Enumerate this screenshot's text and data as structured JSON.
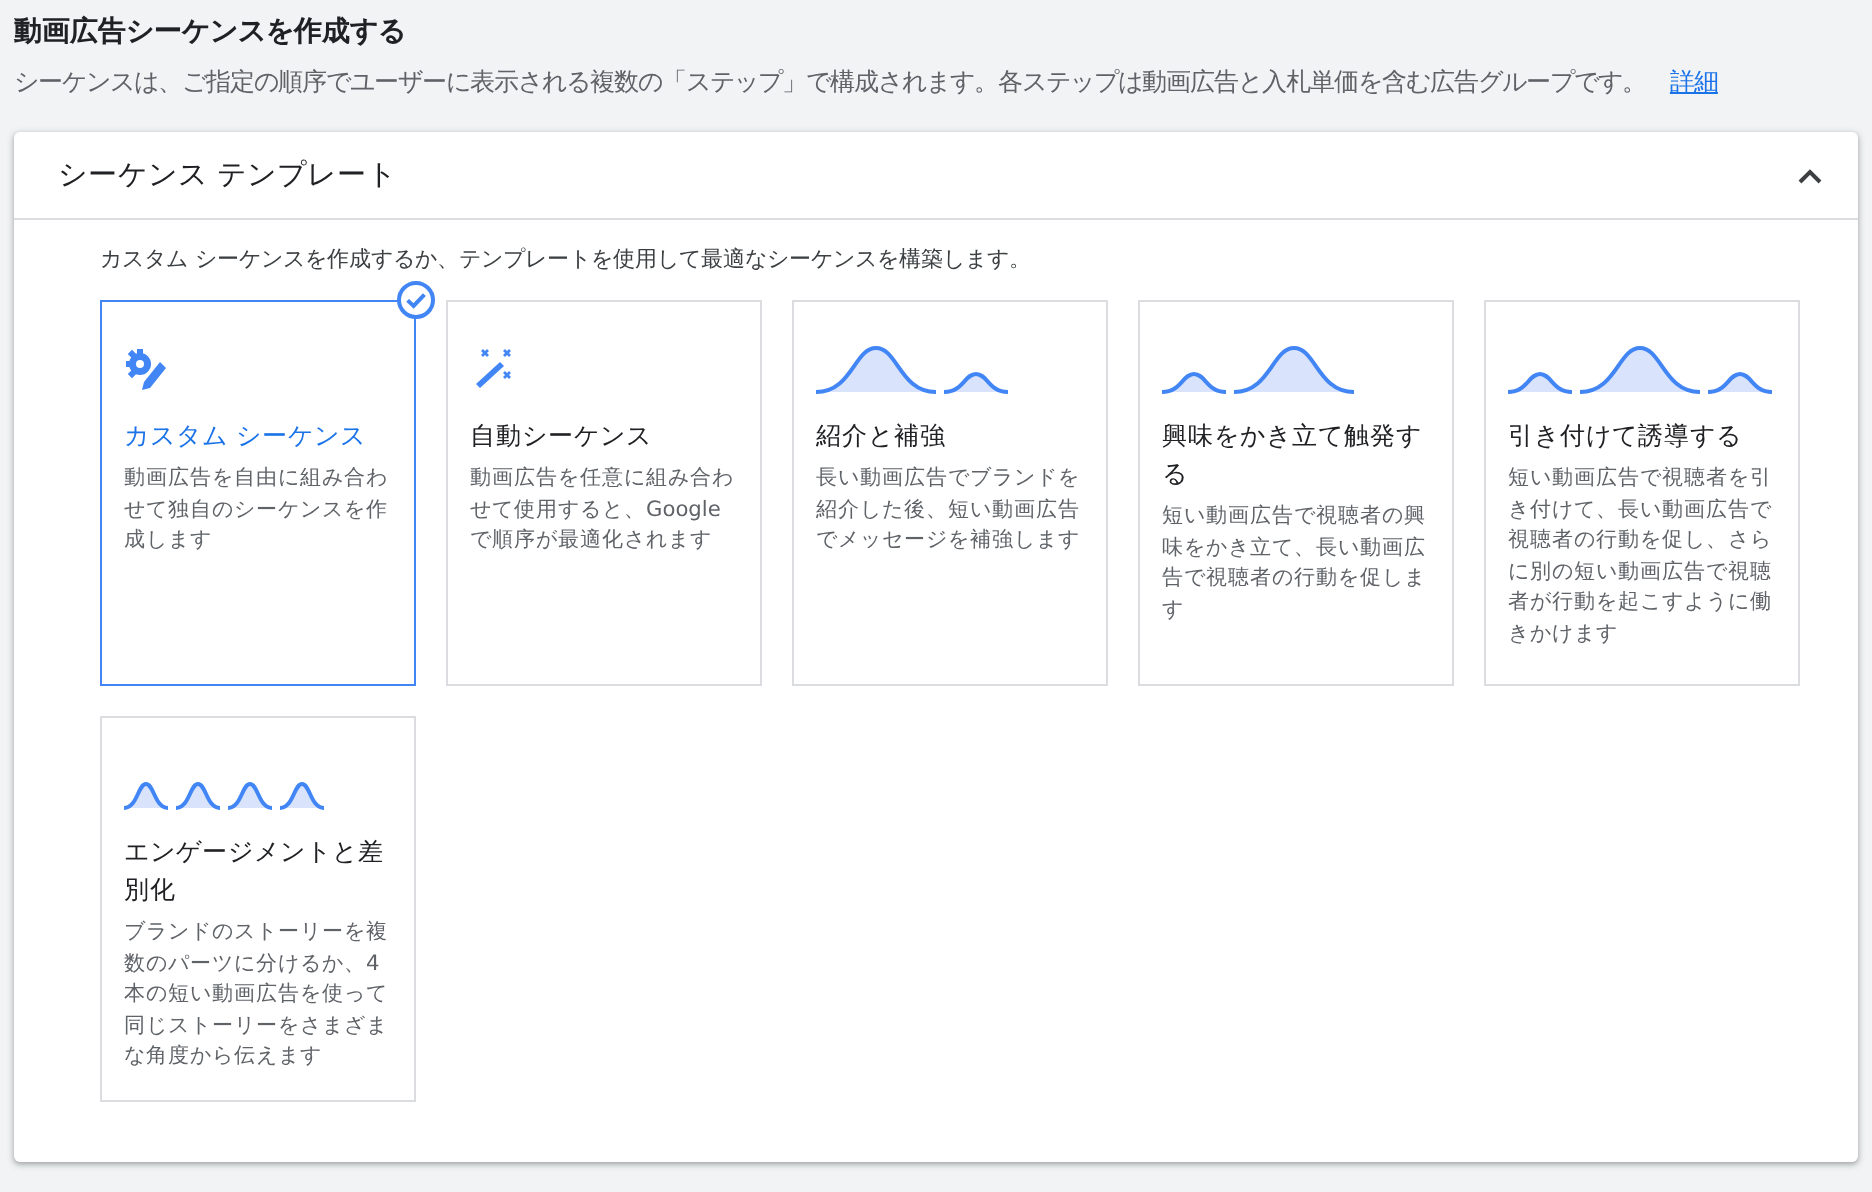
{
  "page": {
    "title": "動画広告シーケンスを作成する",
    "description": "シーケンスは、ご指定の順序でユーザーに表示される複数の「ステップ」で構成されます。各ステップは動画広告と入札単価を含む広告グループです。",
    "link": "詳細"
  },
  "panel": {
    "title": "シーケンス テンプレート",
    "expanded": true,
    "intro": "カスタム シーケンスを作成するか、テンプレートを使用して最適なシーケンスを構築します。",
    "templates": [
      {
        "kind": "custom",
        "selected": true,
        "title": "カスタム シーケンス",
        "description": "動画広告を自由に組み合わせて独自のシーケンスを作成します"
      },
      {
        "kind": "auto",
        "selected": false,
        "title": "自動シーケンス",
        "description": "動画広告を任意に組み合わせて使用すると、Google で順序が最適化されます"
      },
      {
        "kind": "longshort",
        "selected": false,
        "title": "紹介と補強",
        "description": "長い動画広告でブランドを紹介した後、短い動画広告でメッセージを補強します"
      },
      {
        "kind": "shortlong",
        "selected": false,
        "title": "興味をかき立て触発する",
        "description": "短い動画広告で視聴者の興味をかき立て、長い動画広告で視聴者の行動を促します"
      },
      {
        "kind": "shortlongshort",
        "selected": false,
        "title": "引き付けて誘導する",
        "description": "短い動画広告で視聴者を引き付けて、長い動画広告で視聴者の行動を促し、さらに別の短い動画広告で視聴者が行動を起こすように働きかけます"
      },
      {
        "kind": "shorts",
        "selected": false,
        "title": "エンゲージメントと差別化",
        "description": "ブランドのストーリーを複数のパーツに分けるか、4 本の短い動画広告を使って同じストーリーをさまざまな角度から伝えます"
      }
    ]
  }
}
